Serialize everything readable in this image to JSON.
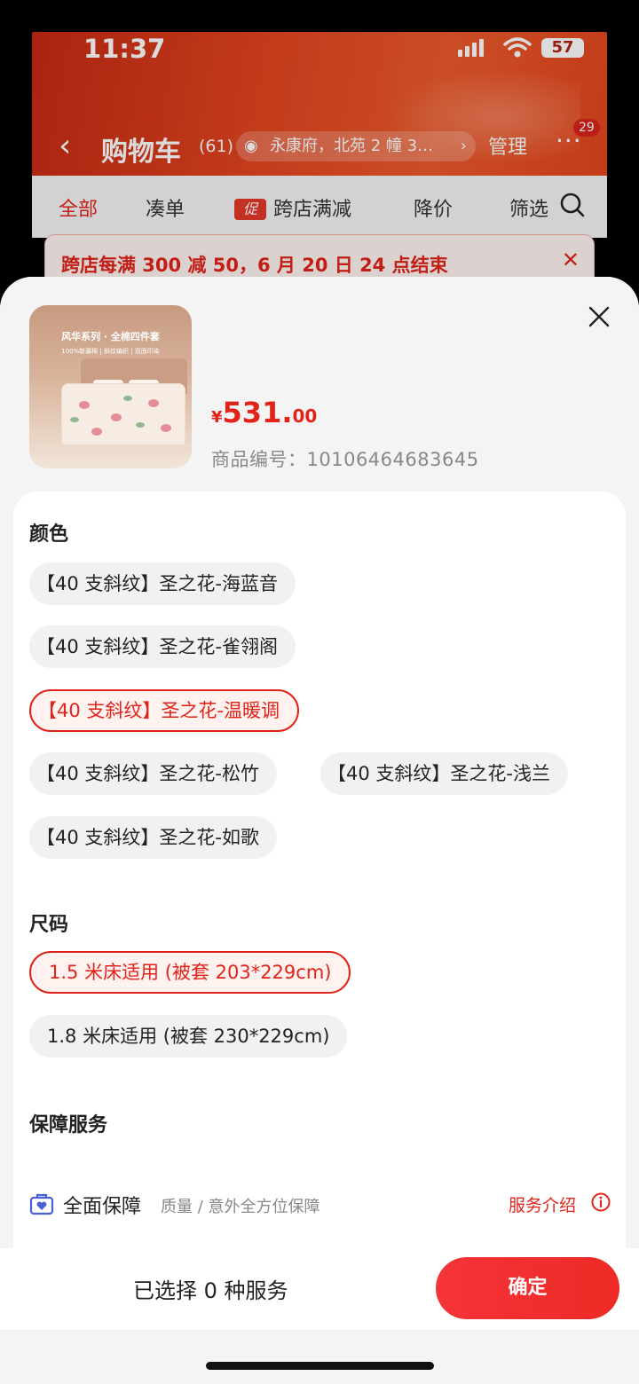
{
  "status_bar": {
    "time": "11:37",
    "battery": "57"
  },
  "cart_header": {
    "title": "购物车",
    "count": "(61)",
    "address": "永康府，北苑 2 幢 3…",
    "manage": "管理",
    "more_badge": "29"
  },
  "filters": {
    "items": [
      "全部",
      "凑单",
      "跨店满减",
      "降价",
      "筛选"
    ],
    "promo_icon_text": "促"
  },
  "notice": {
    "text": "跨店每满 300 减 50，6 月 20 日 24 点结束"
  },
  "product": {
    "image_title": "风华系列 · 全棉四件套",
    "image_subtitle": "100%新疆棉 | 斜纹编织 | 双面印染",
    "price_symbol": "¥",
    "price_int": "531.",
    "price_dec": "00",
    "sku": "商品编号：10106464683645"
  },
  "color_section": {
    "title": "颜色",
    "options": [
      "【40 支斜纹】圣之花-海蓝音",
      "【40 支斜纹】圣之花-雀翎阁",
      "【40 支斜纹】圣之花-温暖调",
      "【40 支斜纹】圣之花-松竹",
      "【40 支斜纹】圣之花-浅兰",
      "【40 支斜纹】圣之花-如歌"
    ],
    "selected": "【40 支斜纹】圣之花-温暖调"
  },
  "size_section": {
    "title": "尺码",
    "options": [
      "1.5 米床适用 (被套 203*229cm)",
      "1.8 米床适用 (被套 230*229cm)"
    ],
    "selected": "1.5 米床适用 (被套 203*229cm)"
  },
  "service_section": {
    "title": "保障服务",
    "item": {
      "name": "全面保障",
      "desc": "质量 / 意外全方位保障",
      "link": "服务介绍"
    }
  },
  "bottom": {
    "selected_text": "已选择 0 种服务",
    "confirm": "确定"
  },
  "colors": {
    "accent": "#e2231a",
    "chip_bg": "#f1f1f1",
    "selected_bg": "#fff2ef"
  }
}
